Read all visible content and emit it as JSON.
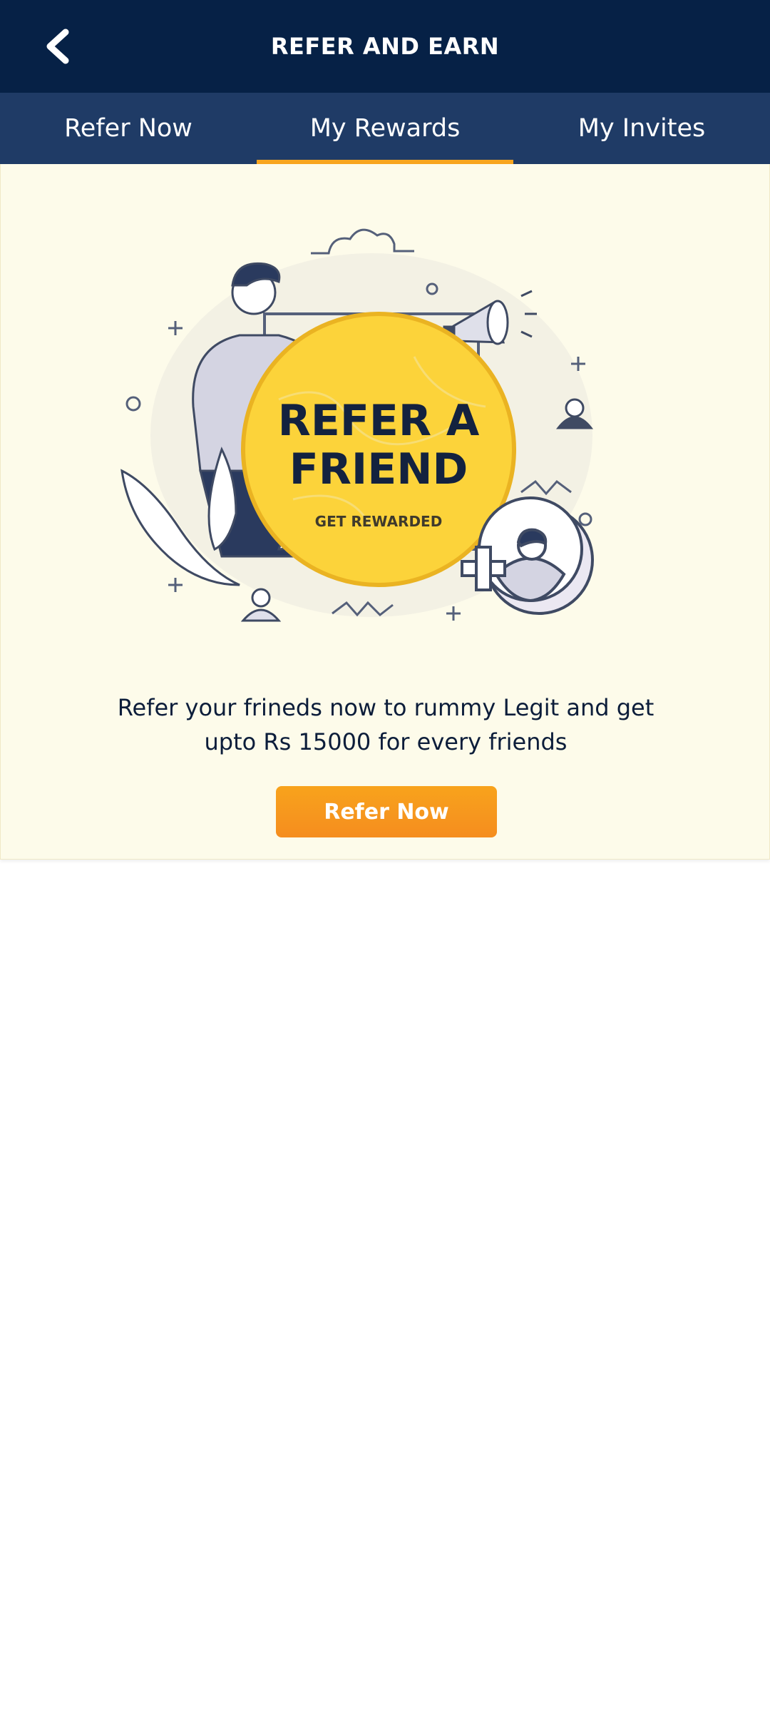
{
  "header": {
    "title": "REFER AND EARN",
    "back_icon": "chevron-left-icon"
  },
  "tabs": [
    {
      "label": "Refer Now",
      "active": false
    },
    {
      "label": "My Rewards",
      "active": true
    },
    {
      "label": "My Invites",
      "active": false
    }
  ],
  "banner": {
    "headline_line1": "REFER A",
    "headline_line2": "FRIEND",
    "subline": "GET REWARDED"
  },
  "content": {
    "description_line1": "Refer your frineds now to rummy Legit and get",
    "description_line2": "upto Rs 15000 for every friends",
    "button_label": "Refer Now"
  },
  "colors": {
    "header_bg": "#062146",
    "tab_bg": "#1f3b66",
    "accent": "#f8a51e",
    "card_bg": "#fdfbea",
    "circle_yellow": "#fcd33a"
  }
}
